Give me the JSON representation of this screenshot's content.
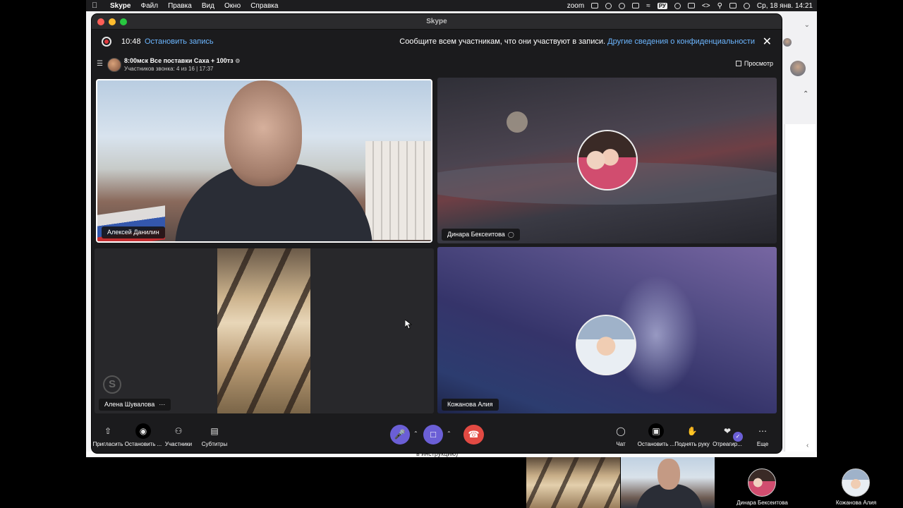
{
  "menubar": {
    "app_name": "Skype",
    "items": [
      "Файл",
      "Правка",
      "Вид",
      "Окно",
      "Справка"
    ],
    "status_zoom": "zoom",
    "language": "РУ",
    "datetime": "Ср, 18 янв.  14:21"
  },
  "window": {
    "title": "Skype"
  },
  "recording": {
    "elapsed": "10:48",
    "stop_label": "Остановить запись",
    "notice": "Сообщите всем участникам, что они участвуют в записи.",
    "privacy_link": "Другие сведения о конфиденциальности"
  },
  "call": {
    "title": "8:00мск Все поставки Саха + 100тз",
    "subtitle": "Участников звонка: 4 из 16 | 17:37",
    "view_label": "Просмотр"
  },
  "participants": [
    {
      "name": "Алексей Данилин"
    },
    {
      "name": "Динара Бексеитова"
    },
    {
      "name": "Алена Шувалова"
    },
    {
      "name": "Кожанова Алия"
    }
  ],
  "toolbar": {
    "invite": "Пригласить",
    "stop_recording": "Остановить ...",
    "participants": "Участники",
    "subtitles": "Субтитры",
    "chat": "Чат",
    "stop_share": "Остановить ...",
    "raise_hand": "Поднять руку",
    "react": "Отреагир...",
    "more": "Еще"
  },
  "thumbnails": [
    {
      "name": ""
    },
    {
      "name": ""
    },
    {
      "name": "Динара Бексеитова"
    },
    {
      "name": "Кожанова Алия"
    }
  ],
  "background": {
    "partial_text": "в инструкцию)"
  },
  "icons": {
    "apple": "apple-icon",
    "rec": "record-icon",
    "close": "close-icon",
    "menu": "hamburger-icon",
    "mic": "microphone-icon",
    "camera": "camera-icon",
    "hangup": "hang-up-icon"
  }
}
